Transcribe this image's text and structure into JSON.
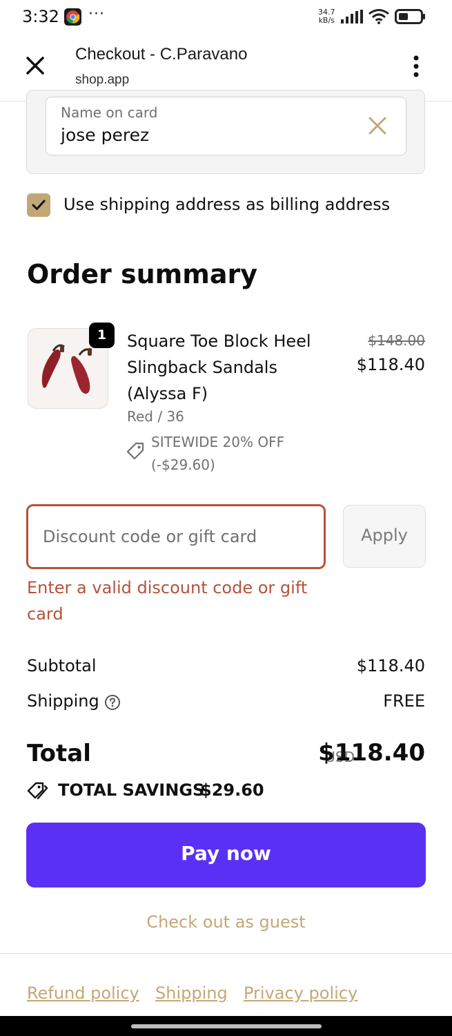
{
  "status_bar": {
    "time": "3:32",
    "more": "···",
    "net_speed_value": "34.7",
    "net_speed_unit": "kB/s"
  },
  "browser": {
    "title": "Checkout - C.Paravano",
    "url": "shop.app"
  },
  "payment": {
    "name_label": "Name on card",
    "name_value": "jose perez",
    "billing_checkbox_label": "Use shipping address as billing address",
    "billing_checked": true
  },
  "order_summary": {
    "title": "Order summary",
    "item": {
      "quantity": "1",
      "name": "Square Toe Block Heel Slingback Sandals (Alyssa F)",
      "variant": "Red / 36",
      "discount_line1": "SITEWIDE 20% OFF",
      "discount_line2": "(-$29.60)",
      "original_price": "$148.00",
      "price": "$118.40"
    },
    "discount_placeholder": "Discount code or gift card",
    "apply_label": "Apply",
    "error": "Enter a valid discount code or gift card",
    "subtotal_label": "Subtotal",
    "subtotal_value": "$118.40",
    "shipping_label": "Shipping",
    "shipping_value": "FREE",
    "total_label": "Total",
    "total_currency": "USD",
    "total_value": "$118.40",
    "savings_label": "TOTAL SAVINGS",
    "savings_value": "$29.60"
  },
  "actions": {
    "pay_label": "Pay now",
    "guest_label": "Check out as guest"
  },
  "footer": {
    "links": [
      "Refund policy",
      "Shipping",
      "Privacy policy"
    ]
  },
  "colors": {
    "accent": "#5a31f4",
    "brand_gold": "#c2a876",
    "error": "#b3533a"
  }
}
